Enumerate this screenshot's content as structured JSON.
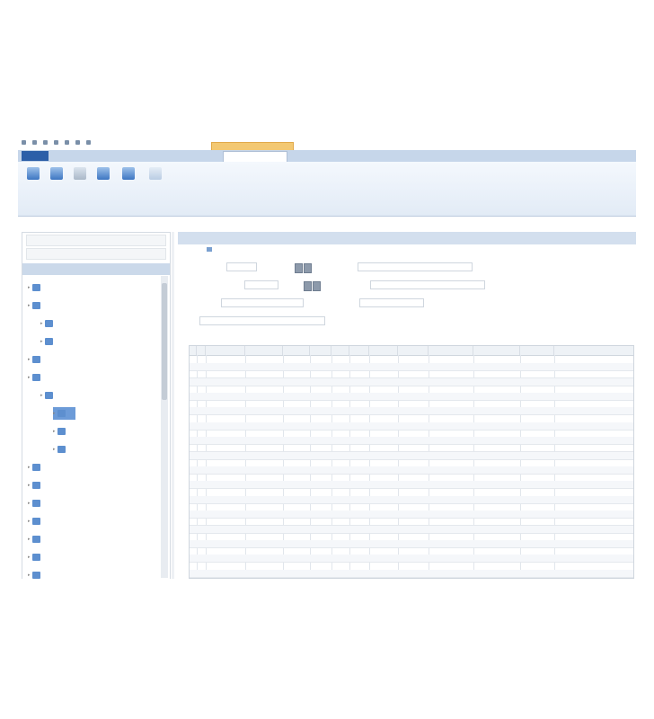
{
  "window": {
    "title": "",
    "contextual_tab": ""
  },
  "ribbon": {
    "file_tab": "",
    "tabs": [
      "",
      "",
      "",
      "",
      "",
      ""
    ],
    "active_tab": 5,
    "buttons": [
      "",
      "",
      "",
      "",
      "",
      "",
      ""
    ]
  },
  "path": "",
  "left_panel": {
    "selectors": [
      "",
      ""
    ],
    "nav_header": "",
    "tree": [
      {
        "label": "",
        "level": 0
      },
      {
        "label": "",
        "level": 0
      },
      {
        "label": "",
        "level": 1
      },
      {
        "label": "",
        "level": 1
      },
      {
        "label": "",
        "level": 0
      },
      {
        "label": "",
        "level": 0
      },
      {
        "label": "",
        "level": 1
      },
      {
        "label": "",
        "level": 2,
        "selected": true
      },
      {
        "label": "",
        "level": 2
      },
      {
        "label": "",
        "level": 2
      },
      {
        "label": "",
        "level": 0
      },
      {
        "label": "",
        "level": 0
      },
      {
        "label": "",
        "level": 0
      },
      {
        "label": "",
        "level": 0
      },
      {
        "label": "",
        "level": 0
      },
      {
        "label": "",
        "level": 0
      },
      {
        "label": "",
        "level": 0
      }
    ]
  },
  "right_panel": {
    "header": "",
    "form": {
      "field1_label": "",
      "field1_value": "",
      "field2_label": "",
      "field2_value": "",
      "field3_label": "",
      "field3_value": "",
      "field4_label": "",
      "field4_value": "",
      "field5_label": "",
      "field5_value": "",
      "field6_label": "",
      "field6_value": "",
      "field7_label": "",
      "field7_value": ""
    },
    "grid": {
      "columns": [
        "",
        "",
        "",
        "",
        "",
        "",
        "",
        "",
        "",
        "",
        "",
        "",
        ""
      ],
      "row_numbers": [
        "",
        "",
        "",
        "",
        "",
        "",
        "",
        "",
        "",
        "",
        "",
        "",
        "",
        "",
        "",
        "",
        "",
        "",
        "",
        "",
        "",
        "",
        "",
        "",
        "",
        "",
        "",
        "",
        "",
        ""
      ]
    }
  },
  "colors": {
    "ribbon_tabs": "#c6d6ea",
    "file_tab": "#2c5fa8",
    "contextual_tab": "#f3c872",
    "selected_tree_item": "#6c9bd8",
    "panel_header": "#d3dfee"
  }
}
